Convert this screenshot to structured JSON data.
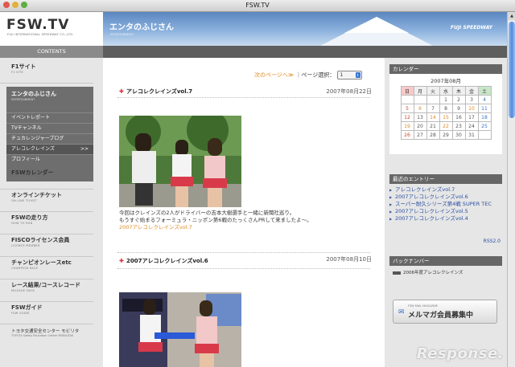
{
  "window": {
    "title": "FSW.TV"
  },
  "header": {
    "logo": "FSW.TV",
    "logo_sub": "FUJI INTERNATIONAL SPEEDWAY CO.,LTD.",
    "banner_title": "エンタのふじさん",
    "banner_sub": "ENTERTAINMENT",
    "fuji_logo": "FUJI SPEEDWAY"
  },
  "sidebar": {
    "contents_label": "CONTENTS",
    "top_item": {
      "ja": "F1サイト",
      "en": "F1 SITE"
    },
    "active": {
      "ja": "エンタのふじさん",
      "en": "ENTERTAINMENT",
      "subs": [
        "イベントレポート",
        "TVチャンネル",
        "チュカレンジャーブログ",
        "アレコレクレインズ",
        "プロフィール"
      ],
      "arrow": ">>"
    },
    "items": [
      {
        "ja": "FSWカレンダー",
        "en": "FSW CALENDAR"
      },
      {
        "ja": "オンラインチケット",
        "en": "ON-LINE TICKET"
      },
      {
        "ja": "FSWの走り方",
        "en": "HOW TO RUN"
      },
      {
        "ja": "FISCOライセンス会員",
        "en": "LICENCE MEMBER"
      },
      {
        "ja": "チャンピオンレースetc",
        "en": "CHAMPION RACE"
      },
      {
        "ja": "レース結果/コースレコード",
        "en": "MILEAGE DATA"
      },
      {
        "ja": "FSWガイド",
        "en": "FSW GUIDE"
      }
    ],
    "footer_org": "トヨタ交通安全センター モビリタ",
    "footer_org_sub": "TOYOTA Safety Education Center MOBILITAS"
  },
  "main": {
    "pager": {
      "next": "次のページへ≫",
      "sep": "｜ページ選択：",
      "selected": "1"
    },
    "entries": [
      {
        "title": "アレコレクレインズvol.7",
        "date": "2007年08月22日",
        "caption1": "今回はクレインズの2人がドライバーの吉本大樹選手と一緒に新聞社巡り。",
        "caption2": "もうすぐ始まるフォーミュラ・ニッポン第6戦のたっくさんPRして来ましたよ〜。",
        "link": "2007アレコレクレインズvol.7"
      },
      {
        "title": "2007アレコレクレインズvol.6",
        "date": "2007年08月10日"
      }
    ]
  },
  "right": {
    "calendar": {
      "title": "カレンダー",
      "month": "2007年08月",
      "dow": [
        "日",
        "月",
        "火",
        "水",
        "木",
        "金",
        "土"
      ],
      "rows": [
        [
          "",
          "",
          "",
          "1",
          "2",
          "3",
          "4"
        ],
        [
          "5",
          "6",
          "7",
          "8",
          "9",
          "10",
          "11"
        ],
        [
          "12",
          "13",
          "14",
          "15",
          "16",
          "17",
          "18"
        ],
        [
          "19",
          "20",
          "21",
          "22",
          "23",
          "24",
          "25"
        ],
        [
          "26",
          "27",
          "28",
          "29",
          "30",
          "31",
          ""
        ]
      ],
      "linked_days": [
        "6",
        "10",
        "14",
        "15",
        "19",
        "22"
      ]
    },
    "recent": {
      "title": "最近のエントリー",
      "items": [
        "アレコレクレインズvol.7",
        "2007アレコレクレインズvol.6",
        "スーパー耐久シリーズ第4戦 SUPER TEC",
        "2007アレコレクレインズvol.5",
        "2007アレコレクレインズvol.4"
      ],
      "rss": "RSS2.0"
    },
    "backnumber": {
      "title": "バックナンバー",
      "item": "2006年度アレコレクレインズ"
    },
    "mail": {
      "small": "FSW MAIL MAGAZINE",
      "big": "メルマガ会員募集中"
    }
  },
  "watermark": "Response."
}
